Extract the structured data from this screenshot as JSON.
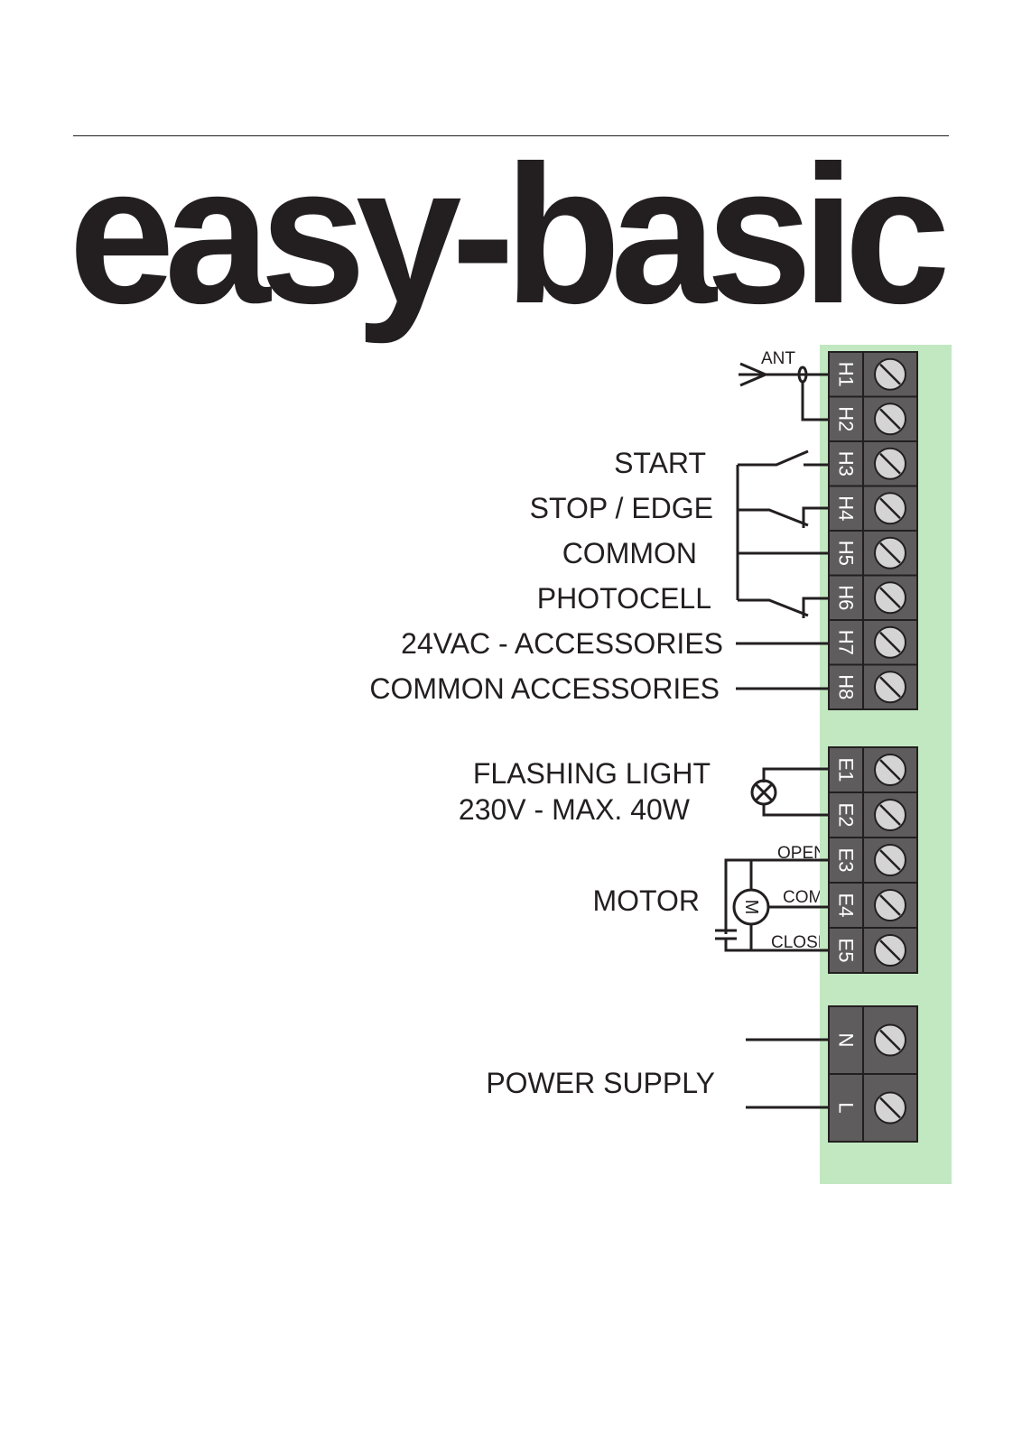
{
  "document": {
    "title": "easy-basic"
  },
  "colors": {
    "board": "#c2e8c2",
    "terminal_block": "#5e5c5c",
    "screw": "#d4d4d4",
    "ink": "#231f20"
  },
  "antenna": {
    "label": "ANT"
  },
  "inputs": {
    "start": "START",
    "stop_edge": "STOP / EDGE",
    "common": "COMMON",
    "photocell": "PHOTOCELL",
    "accessories_24vac": "24VAC - ACCESSORIES",
    "common_accessories": "COMMON ACCESSORIES"
  },
  "flashing_light": {
    "line1": "FLASHING LIGHT",
    "line2": "230V - MAX. 40W"
  },
  "motor": {
    "label": "MOTOR",
    "symbol": "M",
    "open": "OPEN",
    "com": "COM",
    "close": "CLOSE"
  },
  "power": {
    "label": "POWER SUPPLY"
  },
  "terminals": {
    "h": [
      "H1",
      "H2",
      "H3",
      "H4",
      "H5",
      "H6",
      "H7",
      "H8"
    ],
    "e": [
      "E1",
      "E2",
      "E3",
      "E4",
      "E5"
    ],
    "p": [
      "N",
      "L"
    ]
  }
}
